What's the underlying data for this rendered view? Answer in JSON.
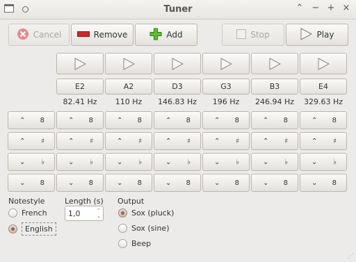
{
  "window": {
    "title": "Tuner"
  },
  "toolbar": {
    "cancel_label": "Cancel",
    "remove_label": "Remove",
    "add_label": "Add",
    "stop_label": "Stop",
    "play_label": "Play"
  },
  "strings": [
    {
      "note": "E2",
      "freq": "82.41 Hz"
    },
    {
      "note": "A2",
      "freq": "110 Hz"
    },
    {
      "note": "D3",
      "freq": "146.83 Hz"
    },
    {
      "note": "G3",
      "freq": "196 Hz"
    },
    {
      "note": "B3",
      "freq": "246.94 Hz"
    },
    {
      "note": "E4",
      "freq": "329.63 Hz"
    }
  ],
  "controls": {
    "octave_up": "8",
    "sharp": "♯",
    "flat": "♭",
    "octave_down": "8"
  },
  "notestyle": {
    "label": "Notestyle",
    "options": [
      "French",
      "English"
    ],
    "selected": "English"
  },
  "length": {
    "label": "Length (s)",
    "value": "1,0"
  },
  "output": {
    "label": "Output",
    "options": [
      "Sox (pluck)",
      "Sox (sine)",
      "Beep"
    ],
    "selected": "Sox (pluck)"
  },
  "colors": {
    "remove_red": "#cc2a2a",
    "add_green": "#4caf2a",
    "cancel_red": "#e06666"
  }
}
